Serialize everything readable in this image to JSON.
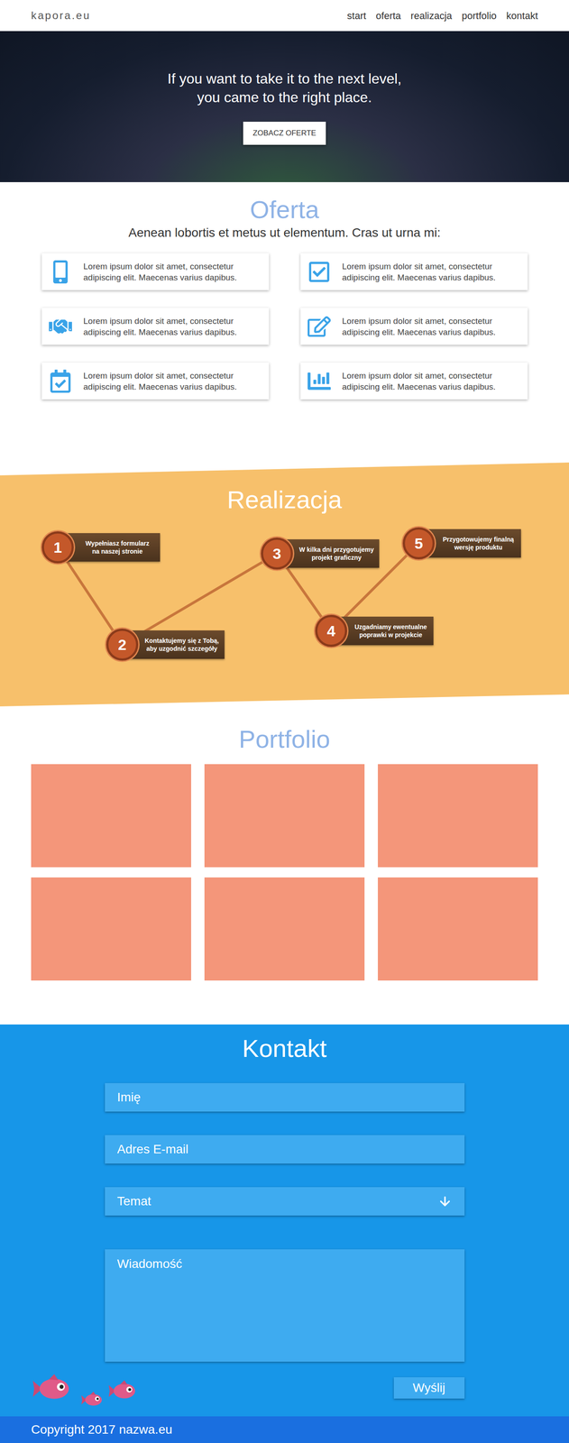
{
  "nav": {
    "logo": "kapora.eu",
    "links": [
      "start",
      "oferta",
      "realizacja",
      "portfolio",
      "kontakt"
    ]
  },
  "hero": {
    "lines": [
      "If you want to take it to the next level,",
      "you came to the right place."
    ],
    "button": "ZOBACZ OFERTE"
  },
  "oferta": {
    "title": "Oferta",
    "subtitle": "Aenean lobortis et metus ut elementum. Cras ut urna mi:",
    "cards": [
      {
        "text": "Lorem ipsum dolor sit amet, consectetur adipiscing elit. Maecenas varius dapibus."
      },
      {
        "text": "Lorem ipsum dolor sit amet, consectetur adipiscing elit. Maecenas varius dapibus."
      },
      {
        "text": "Lorem ipsum dolor sit amet, consectetur adipiscing elit. Maecenas varius dapibus."
      },
      {
        "text": "Lorem ipsum dolor sit amet, consectetur adipiscing elit. Maecenas varius dapibus."
      },
      {
        "text": "Lorem ipsum dolor sit amet, consectetur adipiscing elit. Maecenas varius dapibus."
      },
      {
        "text": "Lorem ipsum dolor sit amet, consectetur adipiscing elit. Maecenas varius dapibus."
      }
    ]
  },
  "realizacja": {
    "title": "Realizacja",
    "steps": [
      {
        "number": "1",
        "lines": [
          "Wypełniasz formularz",
          "na naszej stronie"
        ]
      },
      {
        "number": "2",
        "lines": [
          "Kontaktujemy się z Tobą,",
          "aby uzgodnić szczegóły"
        ]
      },
      {
        "number": "3",
        "lines": [
          "W kilka dni przygotujemy",
          "projekt graficzny"
        ]
      },
      {
        "number": "4",
        "lines": [
          "Uzgadniamy ewentualne",
          "poprawki w projekcie"
        ]
      },
      {
        "number": "5",
        "lines": [
          "Przygotowujemy finalną",
          "wersję produktu"
        ]
      }
    ]
  },
  "portfolio": {
    "title": "Portfolio",
    "tiles": [
      {
        "kind": "placeholder"
      },
      {
        "kind": "placeholder"
      },
      {
        "kind": "placeholder"
      },
      {
        "kind": "placeholder"
      },
      {
        "kind": "placeholder"
      },
      {
        "kind": "placeholder"
      }
    ]
  },
  "kontakt": {
    "title": "Kontakt",
    "fields": [
      {
        "kind": "text",
        "placeholder": "Imię"
      },
      {
        "kind": "text",
        "placeholder": "Adres E-mail"
      },
      {
        "kind": "select",
        "placeholder": "Temat"
      },
      {
        "kind": "textarea",
        "placeholder": "Wiadomość"
      }
    ],
    "button": "Wyślij"
  },
  "footer": {
    "text": "Copyright 2017 nazwa.eu"
  }
}
